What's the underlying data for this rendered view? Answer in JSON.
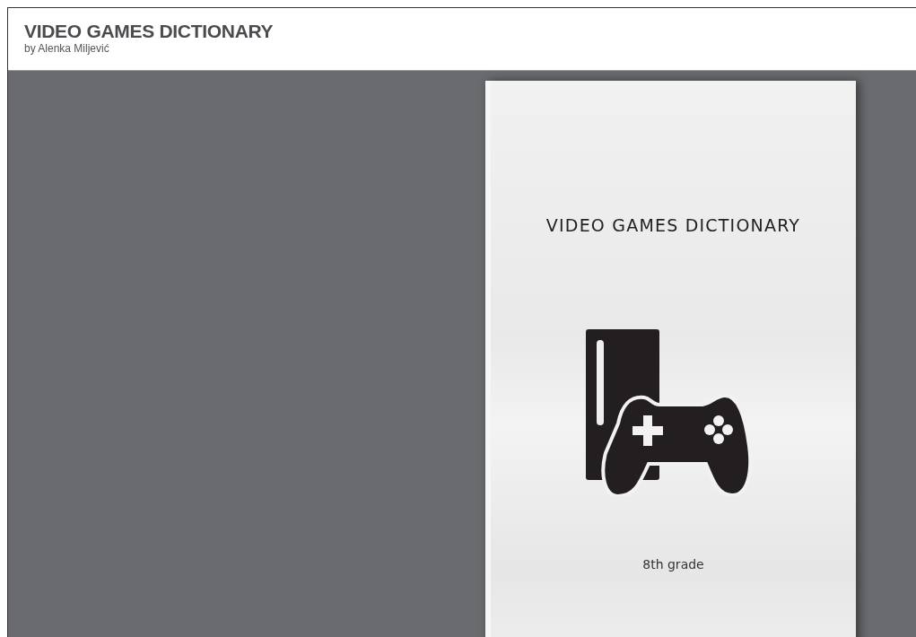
{
  "header": {
    "title": "VIDEO GAMES DICTIONARY",
    "author": "by Alenka Miljević"
  },
  "book": {
    "cover_title": "VIDEO GAMES DICTIONARY",
    "cover_subtitle": "8th grade"
  }
}
